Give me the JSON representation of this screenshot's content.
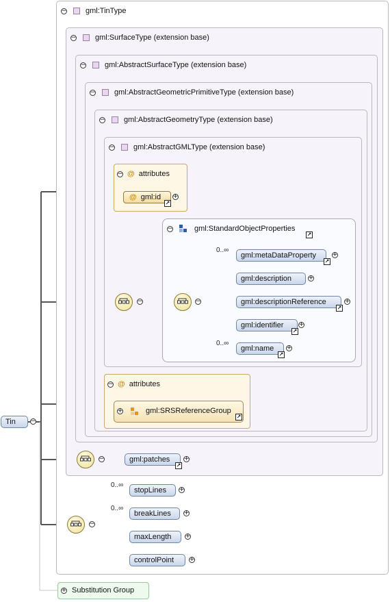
{
  "boxes": {
    "tin_type": "gml:TinType",
    "surface_type": "gml:SurfaceType (extension base)",
    "abstract_surface_type": "gml:AbstractSurfaceType (extension base)",
    "abstract_geometric_primitive_type": "gml:AbstractGeometricPrimitiveType (extension base)",
    "abstract_geometry_type": "gml:AbstractGeometryType (extension base)",
    "abstract_gml_type": "gml:AbstractGMLType (extension base)"
  },
  "attributes_label": "attributes",
  "attributes_label_2": "attributes",
  "attr_gml_id": "gml:id",
  "srs_group": "gml:SRSReferenceGroup",
  "std_obj_props": "gml:StandardObjectProperties",
  "std_elements": [
    {
      "label": "gml:metaDataProperty",
      "card": "0..∞"
    },
    {
      "label": "gml:description",
      "card": ""
    },
    {
      "label": "gml:descriptionReference",
      "card": ""
    },
    {
      "label": "gml:identifier",
      "card": ""
    },
    {
      "label": "gml:name",
      "card": "0..∞"
    }
  ],
  "root": "Tin",
  "patches": "gml:patches",
  "tin_elements": [
    {
      "label": "stopLines",
      "card": "0..∞"
    },
    {
      "label": "breakLines",
      "card": "0..∞"
    },
    {
      "label": "maxLength",
      "card": ""
    },
    {
      "label": "controlPoint",
      "card": ""
    }
  ],
  "substitution_group": "Substitution Group",
  "glyphs": {
    "minus": "−",
    "plus": "+",
    "at": "@",
    "link": "↗"
  },
  "icons": [
    "collapse-icon",
    "expand-icon",
    "complex-type-icon",
    "sequence-compositor-icon",
    "attribute-icon",
    "group-icon",
    "reference-link-icon"
  ]
}
